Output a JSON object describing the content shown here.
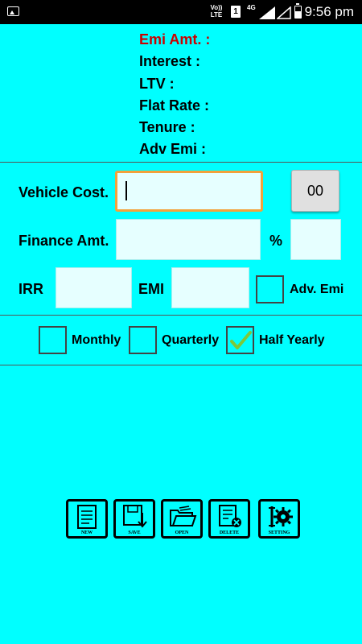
{
  "status_bar": {
    "volte": "Vo)) LTE",
    "sim": "1",
    "network": "4G",
    "time": "9:56 pm"
  },
  "summary": {
    "emi_amt": "Emi Amt. :",
    "interest": "Interest :",
    "ltv": "LTV :",
    "flat_rate": "Flat Rate :",
    "tenure": "Tenure :",
    "adv_emi": "Adv Emi :"
  },
  "form": {
    "vehicle_cost_label": "Vehicle Cost.",
    "vehicle_cost_value": "",
    "button_00": "00",
    "finance_amt_label": "Finance Amt.",
    "finance_amt_value": "",
    "percent_label": "%",
    "percent_value": "",
    "irr_label": "IRR",
    "irr_value": "",
    "emi_label": "EMI",
    "emi_value": "",
    "adv_emi_label": "Adv. Emi",
    "adv_emi_checked": false
  },
  "frequency": {
    "monthly_label": "Monthly",
    "monthly_checked": false,
    "quarterly_label": "Quarterly",
    "quarterly_checked": false,
    "half_yearly_label": "Half Yearly",
    "half_yearly_checked": true
  },
  "toolbar": {
    "new_label": "NEW",
    "save_label": "SAVE",
    "open_label": "OPEN",
    "delete_label": "DELETE",
    "setting_label": "SETTING"
  },
  "colors": {
    "background": "#00FFFF",
    "emi_highlight": "#CC0000",
    "focus_border": "#F2A23A",
    "check_green": "#7DC83A"
  }
}
